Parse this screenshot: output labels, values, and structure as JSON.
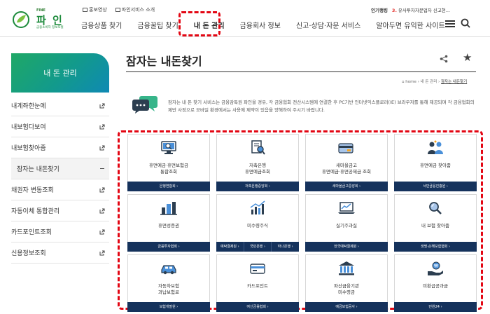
{
  "logo": {
    "fine": "FINE",
    "name": "파 인",
    "tagline": "금융소비자 정보포털"
  },
  "util_links": [
    {
      "label": "홍보영상",
      "icon": "video-icon"
    },
    {
      "label": "파인서비스 소개",
      "icon": "document-icon"
    }
  ],
  "ranking": {
    "title": "인기랭킹",
    "rank": "3.",
    "item": "유사투자자문업자 신고현..."
  },
  "gnb": [
    "금융상품 찾기",
    "금융꿀팁 찾기",
    "내 돈 관리",
    "금융회사 정보",
    "신고·상담·자문 서비스",
    "알아두면 유익한 사이트"
  ],
  "sidebar": {
    "title": "내 돈 관리",
    "items": [
      {
        "label": "내계좌한눈에",
        "type": "external"
      },
      {
        "label": "내보험다보여",
        "type": "external"
      },
      {
        "label": "내보험찾아줌",
        "type": "external"
      },
      {
        "label": "잠자는 내돈찾기",
        "type": "current"
      },
      {
        "label": "채권자 변동조회",
        "type": "external"
      },
      {
        "label": "자동이체 통합관리",
        "type": "external"
      },
      {
        "label": "카드포인트조회",
        "type": "external"
      },
      {
        "label": "신용정보조회",
        "type": "external"
      }
    ]
  },
  "page": {
    "title": "잠자는 내돈찾기",
    "breadcrumb": {
      "home": "home",
      "sep": "›",
      "section": "내 돈 관리",
      "current": "잠자는 내돈찾기"
    },
    "intro": "잠자는 내 돈 찾기 서비스는 금융감독원 파인을 경유, 각 금융협회 전산시스템에 연결한 후 PC기반 인터넷익스플로러(IE) 브라우저를 통해 제공되며 각 금융협회의 제반 사정으로 모바일 환경에서는 사용에 제약이 있음을 양해하여 주시기 바랍니다."
  },
  "cards": [
    {
      "label": [
        "휴면예금·휴면보험금",
        "통합조회"
      ],
      "icon": "monitor-search-icon",
      "links": [
        "은행연합회 ›"
      ]
    },
    {
      "label": [
        "저축은행",
        "휴면예금조회"
      ],
      "icon": "document-search-icon",
      "links": [
        "저축은행중앙회 ›"
      ]
    },
    {
      "label": [
        "새마을금고",
        "휴면예금·휴면공제금 조회"
      ],
      "icon": "credit-card-icon",
      "links": [
        "새마을금고중앙회 ›"
      ]
    },
    {
      "label": [
        "휴면예금 찾아줌"
      ],
      "icon": "people-icon",
      "links": [
        "서민금융진흥원 ›"
      ]
    },
    {
      "label": [
        "휴면성증권"
      ],
      "icon": "building-chart-icon",
      "links": [
        "금융투자협회 ›"
      ]
    },
    {
      "label": [
        "미수령주식"
      ],
      "icon": "bar-chart-icon",
      "links": [
        "예탁결제원 ›",
        "국민은행 ›",
        "하나은행 ›"
      ]
    },
    {
      "label": [
        "실기주과실"
      ],
      "icon": "laptop-chart-icon",
      "links": [
        "한국예탁결제원 ›"
      ]
    },
    {
      "label": [
        "내 보험 찾아줌"
      ],
      "icon": "magnifier-icon",
      "links": [
        "생명·손해보험협회 ›"
      ]
    },
    {
      "label": [
        "자동차보험",
        "과납보험료"
      ],
      "icon": "car-icon",
      "links": [
        "보험개발원 ›"
      ]
    },
    {
      "label": [
        "카드포인트"
      ],
      "icon": "card-icon",
      "links": [
        "여신금융협회 ›"
      ]
    },
    {
      "label": [
        "파산금융기관",
        "미수령금"
      ],
      "icon": "bank-icon",
      "links": [
        "예금보험공사 ›"
      ]
    },
    {
      "label": [
        "미환급공과금"
      ],
      "icon": "hand-coin-icon",
      "links": [
        "민원24 ›"
      ]
    }
  ]
}
